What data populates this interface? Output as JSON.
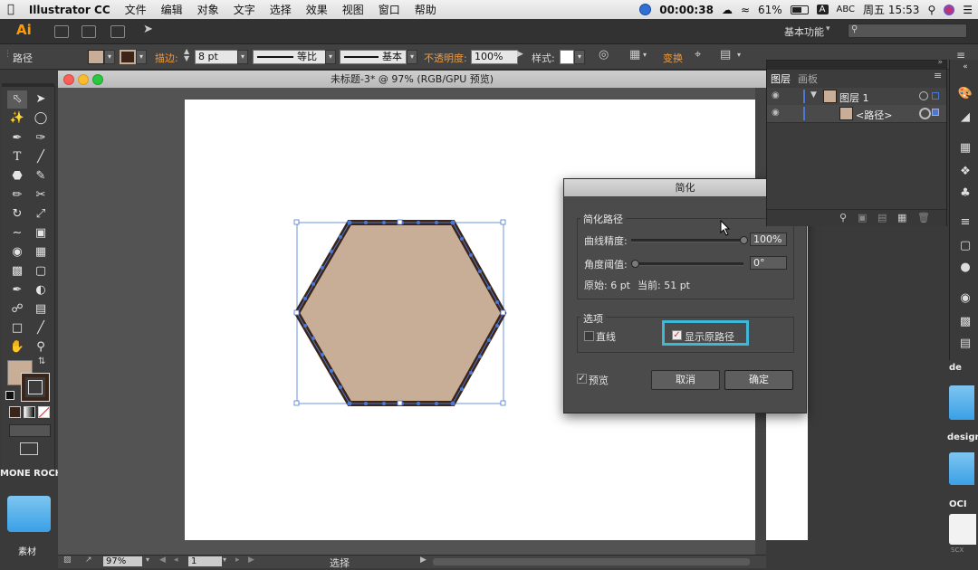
{
  "menubar": {
    "apple": "",
    "app": "Illustrator CC",
    "items": [
      "文件",
      "编辑",
      "对象",
      "文字",
      "选择",
      "效果",
      "视图",
      "窗口",
      "帮助"
    ],
    "timer": "00:00:38",
    "battery": "61%",
    "input_mode": "A",
    "input_label": "ABC",
    "clock": "周五 15:53"
  },
  "appbar": {
    "logo": "Ai",
    "workspace": "基本功能"
  },
  "control_bar": {
    "selection_label": "路径",
    "stroke_label": "描边:",
    "stroke_value": "8 pt",
    "profile_label": "等比",
    "brush_label": "基本",
    "opacity_label": "不透明度:",
    "opacity_value": "100%",
    "style_label": "样式:",
    "transform_label": "变换"
  },
  "document": {
    "title": "未标题-3* @ 97% (RGB/GPU 预览)"
  },
  "dialog": {
    "title": "简化",
    "group1_label": "简化路径",
    "curve_label": "曲线精度:",
    "curve_value": "100%",
    "curve_fraction": 1.0,
    "angle_label": "角度阈值:",
    "angle_value": "0°",
    "angle_fraction": 0.0,
    "original_label": "原始: 6 pt",
    "current_label": "当前: 51 pt",
    "group2_label": "选项",
    "straight_label": "直线",
    "show_original_label": "显示原路径",
    "show_original_checked": true,
    "preview_label": "预览",
    "preview_checked": true,
    "cancel_label": "取消",
    "ok_label": "确定",
    "highlight_color": "#3fb7d6"
  },
  "layers_panel": {
    "tab_layers": "图层",
    "tab_artboards": "画板",
    "rows": [
      {
        "name": "图层 1"
      },
      {
        "name": "<路径>"
      }
    ]
  },
  "shape": {
    "fill_color": "#c8ae97",
    "stroke_color": "#3b2418",
    "selection_color": "#4a78d6"
  },
  "toolbar": {
    "fill_color": "#c8ae97",
    "stroke_color": "#3b2418"
  },
  "desktop": {
    "folder1_title": "MONE ROCH",
    "folder1_label": "素材",
    "right_label1": "de",
    "right_label2": "design",
    "right_label3": "OCI",
    "right_label4": "SCX"
  },
  "status_bar": {
    "zoom": "97%",
    "page": "1",
    "tool": "选择"
  }
}
